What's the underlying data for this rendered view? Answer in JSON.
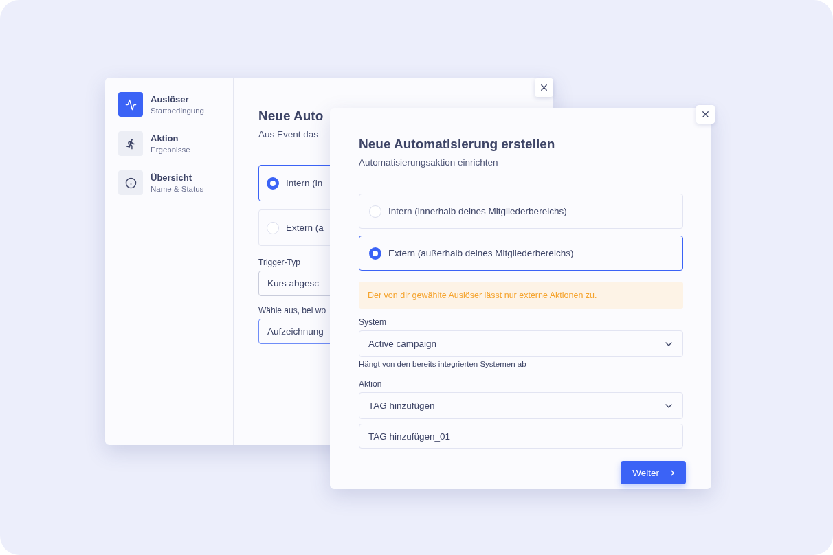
{
  "back_window": {
    "steps": [
      {
        "title": "Auslöser",
        "subtitle": "Startbedingung",
        "kind": "pulse",
        "selected": true
      },
      {
        "title": "Aktion",
        "subtitle": "Ergebnisse",
        "kind": "runner",
        "selected": false
      },
      {
        "title": "Übersicht",
        "subtitle": "Name & Status",
        "kind": "info",
        "selected": false
      }
    ],
    "heading": "Neue Auto",
    "subheading": "Aus Event das",
    "options": [
      {
        "label": "Intern (in",
        "selected": true
      },
      {
        "label": "Extern (a",
        "selected": false
      }
    ],
    "fields": [
      {
        "label": "Trigger-Typ",
        "value": "Kurs abgesc",
        "focused": false
      },
      {
        "label": "Wähle aus, bei wo",
        "value": "Aufzeichnung",
        "focused": true
      }
    ]
  },
  "front_window": {
    "heading": "Neue Automatisierung erstellen",
    "subheading": "Automatisierungsaktion einrichten",
    "options": [
      {
        "label": "Intern (innerhalb deines Mitgliederbereichs)",
        "selected": false
      },
      {
        "label": "Extern (außerhalb deines Mitgliederbereichs)",
        "selected": true
      }
    ],
    "warning": "Der von dir gewählte Auslöser lässt nur externe Aktionen zu.",
    "system": {
      "label": "System",
      "value": "Active campaign",
      "hint": "Hängt von den bereits integrierten Systemen ab"
    },
    "action": {
      "label": "Aktion",
      "value": "TAG hinzufügen",
      "name_value": "TAG hinzufügen_01"
    },
    "button": "Weiter"
  }
}
